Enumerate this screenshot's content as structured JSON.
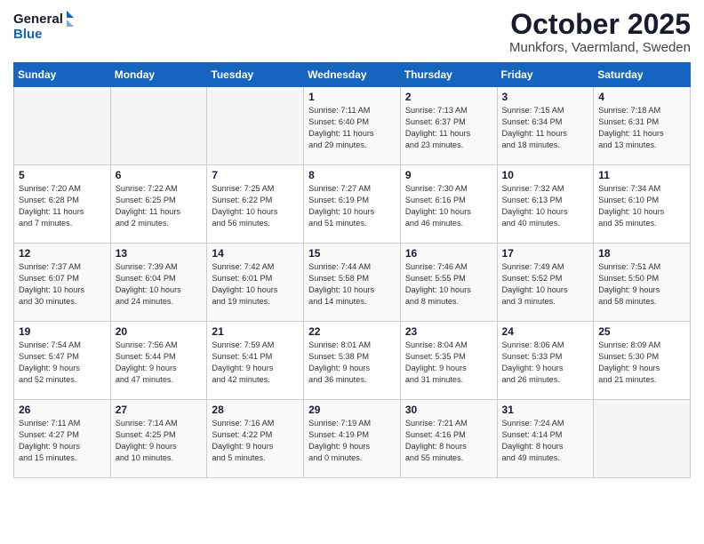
{
  "header": {
    "logo_general": "General",
    "logo_blue": "Blue",
    "month": "October 2025",
    "location": "Munkfors, Vaermland, Sweden"
  },
  "days_of_week": [
    "Sunday",
    "Monday",
    "Tuesday",
    "Wednesday",
    "Thursday",
    "Friday",
    "Saturday"
  ],
  "weeks": [
    [
      {
        "day": "",
        "content": ""
      },
      {
        "day": "",
        "content": ""
      },
      {
        "day": "",
        "content": ""
      },
      {
        "day": "1",
        "content": "Sunrise: 7:11 AM\nSunset: 6:40 PM\nDaylight: 11 hours\nand 29 minutes."
      },
      {
        "day": "2",
        "content": "Sunrise: 7:13 AM\nSunset: 6:37 PM\nDaylight: 11 hours\nand 23 minutes."
      },
      {
        "day": "3",
        "content": "Sunrise: 7:15 AM\nSunset: 6:34 PM\nDaylight: 11 hours\nand 18 minutes."
      },
      {
        "day": "4",
        "content": "Sunrise: 7:18 AM\nSunset: 6:31 PM\nDaylight: 11 hours\nand 13 minutes."
      }
    ],
    [
      {
        "day": "5",
        "content": "Sunrise: 7:20 AM\nSunset: 6:28 PM\nDaylight: 11 hours\nand 7 minutes."
      },
      {
        "day": "6",
        "content": "Sunrise: 7:22 AM\nSunset: 6:25 PM\nDaylight: 11 hours\nand 2 minutes."
      },
      {
        "day": "7",
        "content": "Sunrise: 7:25 AM\nSunset: 6:22 PM\nDaylight: 10 hours\nand 56 minutes."
      },
      {
        "day": "8",
        "content": "Sunrise: 7:27 AM\nSunset: 6:19 PM\nDaylight: 10 hours\nand 51 minutes."
      },
      {
        "day": "9",
        "content": "Sunrise: 7:30 AM\nSunset: 6:16 PM\nDaylight: 10 hours\nand 46 minutes."
      },
      {
        "day": "10",
        "content": "Sunrise: 7:32 AM\nSunset: 6:13 PM\nDaylight: 10 hours\nand 40 minutes."
      },
      {
        "day": "11",
        "content": "Sunrise: 7:34 AM\nSunset: 6:10 PM\nDaylight: 10 hours\nand 35 minutes."
      }
    ],
    [
      {
        "day": "12",
        "content": "Sunrise: 7:37 AM\nSunset: 6:07 PM\nDaylight: 10 hours\nand 30 minutes."
      },
      {
        "day": "13",
        "content": "Sunrise: 7:39 AM\nSunset: 6:04 PM\nDaylight: 10 hours\nand 24 minutes."
      },
      {
        "day": "14",
        "content": "Sunrise: 7:42 AM\nSunset: 6:01 PM\nDaylight: 10 hours\nand 19 minutes."
      },
      {
        "day": "15",
        "content": "Sunrise: 7:44 AM\nSunset: 5:58 PM\nDaylight: 10 hours\nand 14 minutes."
      },
      {
        "day": "16",
        "content": "Sunrise: 7:46 AM\nSunset: 5:55 PM\nDaylight: 10 hours\nand 8 minutes."
      },
      {
        "day": "17",
        "content": "Sunrise: 7:49 AM\nSunset: 5:52 PM\nDaylight: 10 hours\nand 3 minutes."
      },
      {
        "day": "18",
        "content": "Sunrise: 7:51 AM\nSunset: 5:50 PM\nDaylight: 9 hours\nand 58 minutes."
      }
    ],
    [
      {
        "day": "19",
        "content": "Sunrise: 7:54 AM\nSunset: 5:47 PM\nDaylight: 9 hours\nand 52 minutes."
      },
      {
        "day": "20",
        "content": "Sunrise: 7:56 AM\nSunset: 5:44 PM\nDaylight: 9 hours\nand 47 minutes."
      },
      {
        "day": "21",
        "content": "Sunrise: 7:59 AM\nSunset: 5:41 PM\nDaylight: 9 hours\nand 42 minutes."
      },
      {
        "day": "22",
        "content": "Sunrise: 8:01 AM\nSunset: 5:38 PM\nDaylight: 9 hours\nand 36 minutes."
      },
      {
        "day": "23",
        "content": "Sunrise: 8:04 AM\nSunset: 5:35 PM\nDaylight: 9 hours\nand 31 minutes."
      },
      {
        "day": "24",
        "content": "Sunrise: 8:06 AM\nSunset: 5:33 PM\nDaylight: 9 hours\nand 26 minutes."
      },
      {
        "day": "25",
        "content": "Sunrise: 8:09 AM\nSunset: 5:30 PM\nDaylight: 9 hours\nand 21 minutes."
      }
    ],
    [
      {
        "day": "26",
        "content": "Sunrise: 7:11 AM\nSunset: 4:27 PM\nDaylight: 9 hours\nand 15 minutes."
      },
      {
        "day": "27",
        "content": "Sunrise: 7:14 AM\nSunset: 4:25 PM\nDaylight: 9 hours\nand 10 minutes."
      },
      {
        "day": "28",
        "content": "Sunrise: 7:16 AM\nSunset: 4:22 PM\nDaylight: 9 hours\nand 5 minutes."
      },
      {
        "day": "29",
        "content": "Sunrise: 7:19 AM\nSunset: 4:19 PM\nDaylight: 9 hours\nand 0 minutes."
      },
      {
        "day": "30",
        "content": "Sunrise: 7:21 AM\nSunset: 4:16 PM\nDaylight: 8 hours\nand 55 minutes."
      },
      {
        "day": "31",
        "content": "Sunrise: 7:24 AM\nSunset: 4:14 PM\nDaylight: 8 hours\nand 49 minutes."
      },
      {
        "day": "",
        "content": ""
      }
    ]
  ]
}
